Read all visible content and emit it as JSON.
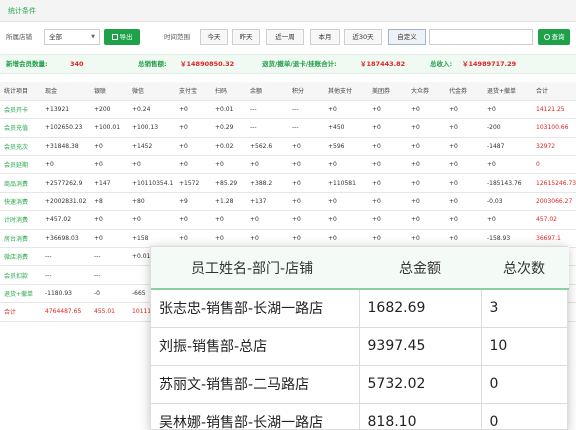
{
  "section_title": "统计条件",
  "filters": {
    "store_label": "所属店铺",
    "store_value": "全部",
    "export_label": "导出",
    "range_label": "时间范围",
    "time_buttons": [
      "今天",
      "昨天",
      "近一周",
      "本月",
      "近30天",
      "自定义"
    ],
    "active_button": "自定义",
    "query_label": "查询"
  },
  "summary": {
    "new_members_label": "新增会员数量:",
    "new_members_value": "340",
    "total_sales_label": "总销售额:",
    "total_sales_value": "￥14890850.32",
    "refund_label": "退货/撤单/退卡/挂账合计:",
    "refund_value": "￥187443.82",
    "total_income_label": "总收入:",
    "total_income_value": "￥14989717.29"
  },
  "table": {
    "headers": [
      "统计项目",
      "现金",
      "银联",
      "微信",
      "支付宝",
      "扫码",
      "余额",
      "积分",
      "其他支付",
      "美团券",
      "大众券",
      "代金券",
      "退货+撤单",
      "合计"
    ],
    "rows": [
      [
        "会员开卡",
        "+13921",
        "+200",
        "+0.24",
        "+0",
        "+0.01",
        "---",
        "---",
        "+0",
        "+0",
        "+0",
        "+0",
        "+0",
        "14121.25"
      ],
      [
        "会员充值",
        "+102650.23",
        "+100.01",
        "+100.13",
        "+0",
        "+0.29",
        "---",
        "---",
        "+450",
        "+0",
        "+0",
        "+0",
        "-200",
        "103100.66"
      ],
      [
        "会员充次",
        "+31848.38",
        "+0",
        "+1452",
        "+0",
        "+0.02",
        "+562.6",
        "+0",
        "+596",
        "+0",
        "+0",
        "+0",
        "-1487",
        "32972"
      ],
      [
        "会员延期",
        "+0",
        "+0",
        "+0",
        "+0",
        "+0",
        "+0",
        "+0",
        "+0",
        "+0",
        "+0",
        "+0",
        "+0",
        "0"
      ],
      [
        "商品消费",
        "+2577262.9",
        "+147",
        "+10110354.1",
        "+1572",
        "+85.29",
        "+388.2",
        "+0",
        "+110581",
        "+0",
        "+0",
        "+0",
        "-185143.76",
        "12615246.73"
      ],
      [
        "快速消费",
        "+2002831.02",
        "+8",
        "+80",
        "+9",
        "+1.28",
        "+137",
        "+0",
        "+0",
        "+0",
        "+0",
        "+0",
        "-0.03",
        "2003066.27"
      ],
      [
        "计时消费",
        "+457.02",
        "+0",
        "+0",
        "+0",
        "+0",
        "+0",
        "+0",
        "+0",
        "+0",
        "+0",
        "+0",
        "+0",
        "457.02"
      ],
      [
        "房台消费",
        "+36698.03",
        "+0",
        "+158",
        "+0",
        "+0",
        "+0",
        "+0",
        "+0",
        "+0",
        "+0",
        "+0",
        "-158.93",
        "36697.1"
      ],
      [
        "微店消费",
        "---",
        "---",
        "+0.01",
        "",
        "",
        "",
        "",
        "",
        "",
        "",
        "",
        "",
        ""
      ],
      [
        "会员扣款",
        "---",
        "---",
        "",
        "",
        "",
        "",
        "",
        "",
        "",
        "",
        "",
        "",
        ""
      ],
      [
        "退货+撤单",
        "-1180.93",
        "-0",
        "-665",
        "",
        "",
        "",
        "",
        "",
        "",
        "",
        "",
        "",
        ""
      ],
      [
        "合计",
        "4764487.65",
        "455.01",
        "10111",
        "",
        "",
        "",
        "",
        "",
        "",
        "",
        "",
        "",
        ""
      ]
    ]
  },
  "popup": {
    "headers": [
      "员工姓名-部门-店铺",
      "总金额",
      "总次数"
    ],
    "rows": [
      [
        "张志忠-销售部-长湖一路店",
        "1682.69",
        "3"
      ],
      [
        "刘振-销售部-总店",
        "9397.45",
        "10"
      ],
      [
        "苏丽文-销售部-二马路店",
        "5732.02",
        "0"
      ],
      [
        "吴林娜-销售部-长湖一路店",
        "818.10",
        "0"
      ]
    ]
  }
}
